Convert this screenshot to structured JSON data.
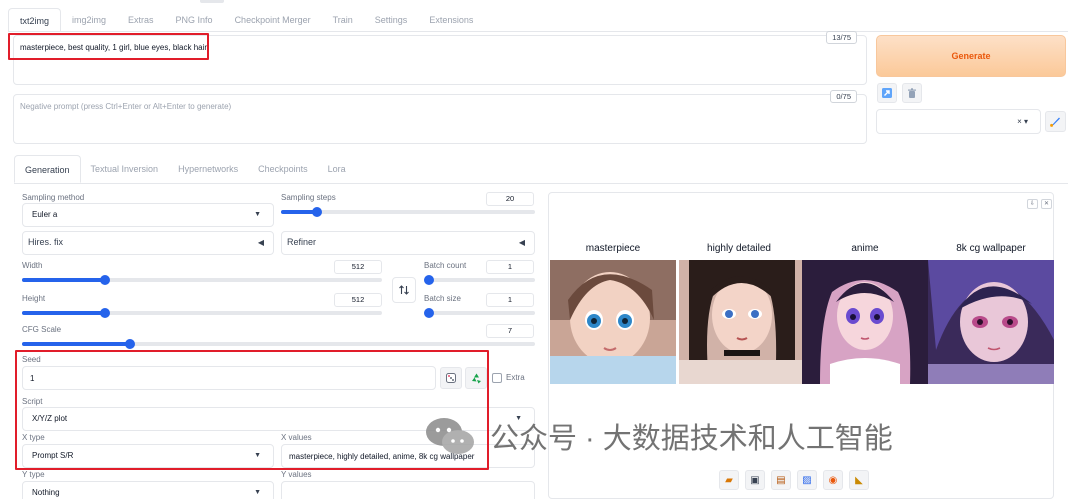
{
  "top_tabs": [
    "txt2img",
    "img2img",
    "Extras",
    "PNG Info",
    "Checkpoint Merger",
    "Train",
    "Settings",
    "Extensions"
  ],
  "prompt": {
    "positive": "masterpiece, best quality, 1 girl, blue eyes, black hair",
    "positive_tokens": "13/75",
    "negative_placeholder": "Negative prompt (press Ctrl+Enter or Alt+Enter to generate)",
    "negative_tokens": "0/75"
  },
  "generate_label": "Generate",
  "style_controls": "× ▾",
  "gen_tabs": [
    "Generation",
    "Textual Inversion",
    "Hypernetworks",
    "Checkpoints",
    "Lora"
  ],
  "settings": {
    "sampling_method_label": "Sampling method",
    "sampling_method_value": "Euler a",
    "sampling_steps_label": "Sampling steps",
    "sampling_steps_value": "20",
    "sampling_steps_fraction": 0.14,
    "hires_fix_label": "Hires. fix",
    "refiner_label": "Refiner",
    "width_label": "Width",
    "width_value": "512",
    "width_fraction": 0.23,
    "height_label": "Height",
    "height_value": "512",
    "height_fraction": 0.23,
    "batch_count_label": "Batch count",
    "batch_count_value": "1",
    "batch_size_label": "Batch size",
    "batch_size_value": "1",
    "cfg_label": "CFG Scale",
    "cfg_value": "7",
    "cfg_fraction": 0.21,
    "seed_label": "Seed",
    "seed_value": "1",
    "extra_label": "Extra",
    "script_label": "Script",
    "script_value": "X/Y/Z plot",
    "x_type_label": "X type",
    "x_type_value": "Prompt S/R",
    "x_values_label": "X values",
    "x_values_value": "masterpiece, highly detailed, anime, 8k cg wallpaper",
    "y_type_label": "Y type",
    "y_type_value": "Nothing",
    "y_values_label": "Y values"
  },
  "gallery": {
    "headers": [
      "masterpiece",
      "highly detailed",
      "anime",
      "8k cg wallpaper"
    ]
  },
  "watermark": "公众号 · 大数据技术和人工智能",
  "colors": {
    "accent": "#2563eb",
    "generate_text": "#ea580c",
    "annotation_red": "#e11d2a"
  }
}
